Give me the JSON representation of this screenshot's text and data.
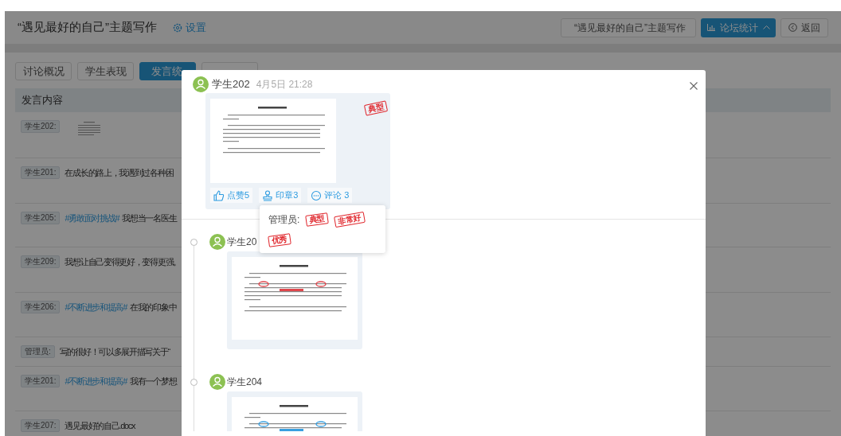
{
  "header": {
    "title": "“遇见最好的自己”主题写作",
    "settings_link": "设置",
    "topic_dropdown": "“遇见最好的自己”主题写作",
    "stats_button": "论坛统计",
    "back_button": "返回"
  },
  "tabs": [
    {
      "label": "讨论概况",
      "selected": false
    },
    {
      "label": "学生表现",
      "selected": false
    },
    {
      "label": "发言统",
      "selected": true
    },
    {
      "selected": false
    }
  ],
  "table": {
    "columns": [
      "发言内容"
    ],
    "rows": [
      {
        "author": "学生202:",
        "kind": "file"
      },
      {
        "author": "学生201:",
        "kind": "text",
        "text": "在成长的路上，我遇到过各种困"
      },
      {
        "author": "学生205:",
        "kind": "text",
        "hashtag": "#勇敢面对挑战#",
        "text": "我想当一名医生"
      },
      {
        "author": "学生209:",
        "kind": "text",
        "text": "我想让自己变得更好，变得更强。"
      },
      {
        "author": "学生206:",
        "kind": "text",
        "hashtag": "#不断进步和提高#",
        "text": "在我的印象中"
      },
      {
        "author": "管理员:",
        "kind": "text",
        "text": "写的很好！可以多展开描写关于“"
      },
      {
        "author": "学生201:",
        "kind": "text",
        "hashtag": "#不断进步和提高#",
        "text": "我有一个梦想"
      },
      {
        "author": "学生207:",
        "kind": "text",
        "text": "遇见最好的自己.docx"
      }
    ]
  },
  "modal": {
    "post": {
      "author": "学生202",
      "time": "4月5日 21:28",
      "stamp": "典型",
      "actions": [
        {
          "kind": "like",
          "label": "点赞5"
        },
        {
          "kind": "stamp",
          "label": "印章3"
        },
        {
          "kind": "comment",
          "label": "评论 3"
        }
      ]
    },
    "popover": {
      "label": "管理员:",
      "stamps": [
        "典型",
        "非常好",
        "优秀"
      ]
    },
    "timeline": [
      {
        "author": "学生20",
        "color": "#e0474c"
      },
      {
        "author": "学生204",
        "color": "#3aa0e0"
      }
    ]
  }
}
